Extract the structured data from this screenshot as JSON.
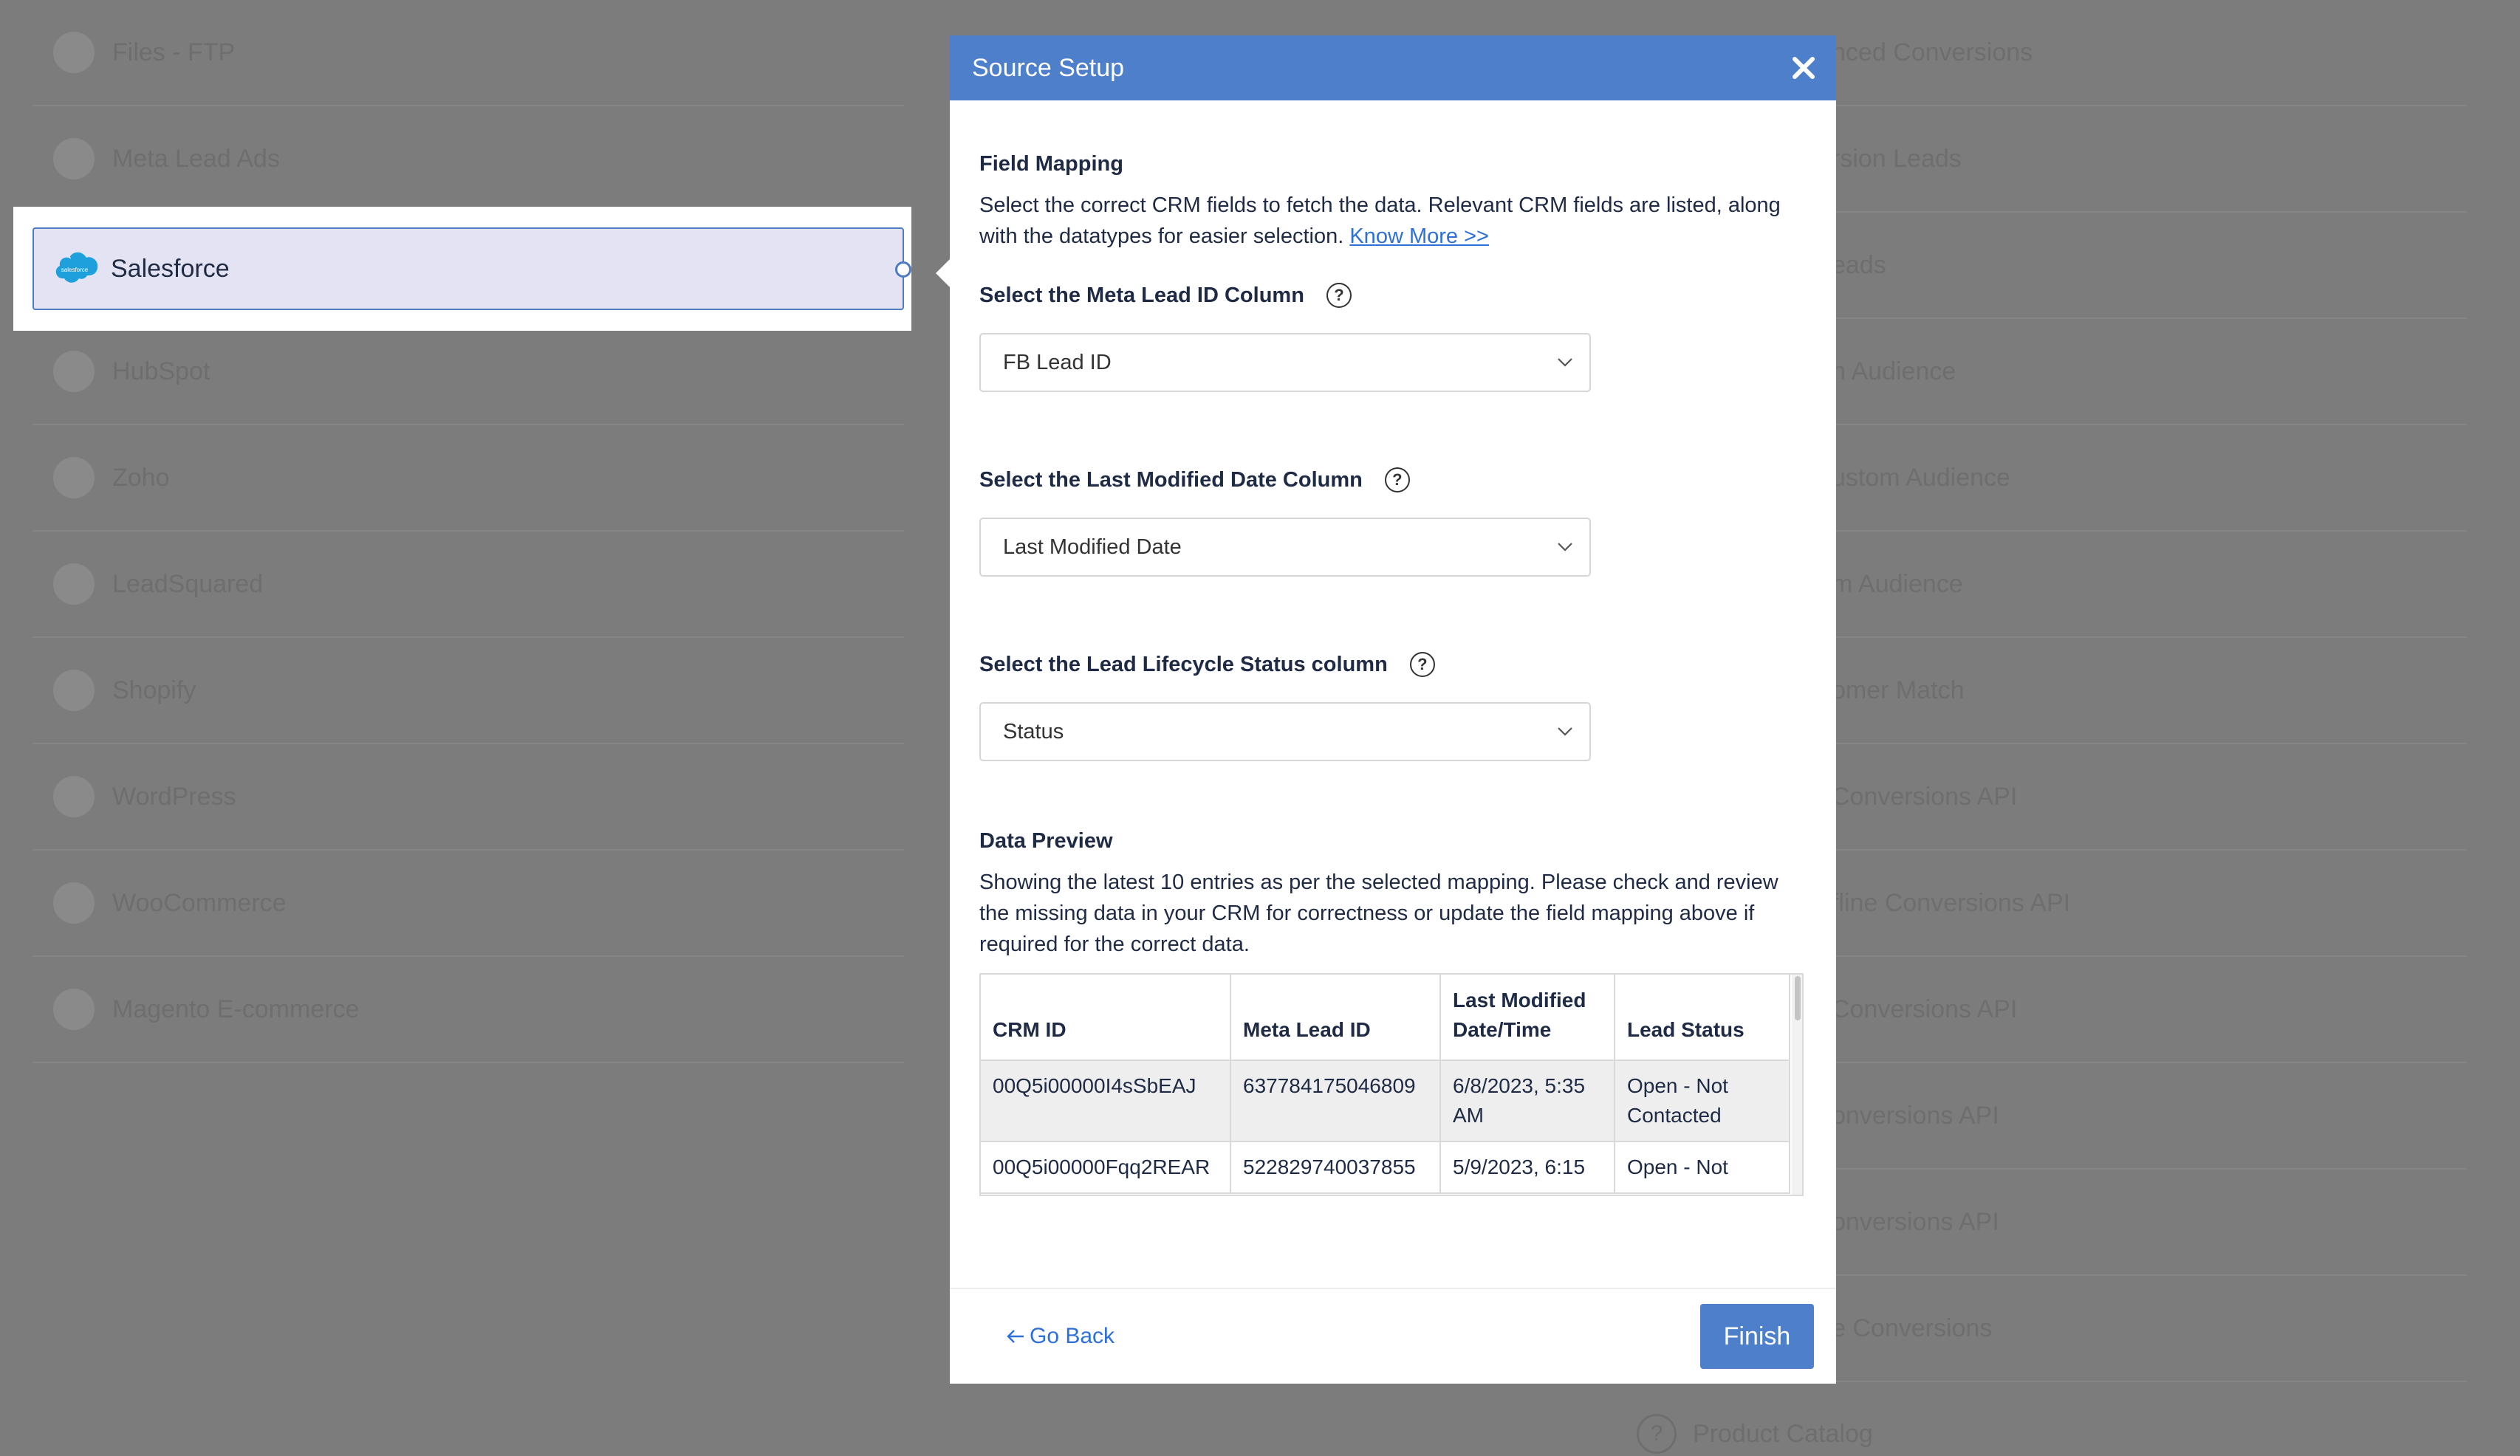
{
  "background": {
    "left_items": [
      {
        "label": "Files - FTP",
        "icon": "ftp-icon"
      },
      {
        "label": "Meta Lead Ads",
        "icon": "meta-icon"
      },
      {
        "label": "",
        "icon": "salesforce-placeholder"
      },
      {
        "label": "HubSpot",
        "icon": "hubspot-icon"
      },
      {
        "label": "Zoho",
        "icon": "zoho-icon"
      },
      {
        "label": "LeadSquared",
        "icon": "leadsquared-icon"
      },
      {
        "label": "Shopify",
        "icon": "shopify-icon"
      },
      {
        "label": "WordPress",
        "icon": "wordpress-icon"
      },
      {
        "label": "WooCommerce",
        "icon": "woocommerce-icon"
      },
      {
        "label": "Magento E-commerce",
        "icon": "magento-icon"
      }
    ],
    "right_items": [
      "nced Conversions",
      "rsion Leads",
      "eads",
      "n Audience",
      "ustom Audience",
      "m Audience",
      "omer Match",
      "Conversions API",
      "fline Conversions API",
      "Conversions API",
      "onversions API",
      "onversions API",
      "e Conversions"
    ],
    "bottom_item": {
      "label": "Product Catalog",
      "icon": "question-icon"
    }
  },
  "selected_source": {
    "label": "Salesforce",
    "icon": "salesforce-cloud-icon"
  },
  "modal": {
    "title": "Source Setup",
    "field_mapping": {
      "title": "Field Mapping",
      "description": "Select the correct CRM fields to fetch the data. Relevant CRM fields are listed, along with the datatypes for easier selection.",
      "link": "Know More >>"
    },
    "fields": [
      {
        "label": "Select the Meta Lead ID Column",
        "value": "FB Lead ID"
      },
      {
        "label": "Select the Last Modified Date Column",
        "value": "Last Modified Date"
      },
      {
        "label": "Select the Lead Lifecycle Status column",
        "value": "Status"
      }
    ],
    "data_preview": {
      "title": "Data Preview",
      "description": "Showing the latest 10 entries as per the selected mapping. Please check and review the missing data in your CRM for correctness or update the field mapping above if required for the correct data.",
      "columns": [
        "CRM ID",
        "Meta Lead ID",
        "Last Modified Date/Time",
        "Lead Status"
      ],
      "rows": [
        [
          "00Q5i00000I4sSbEAJ",
          "637784175046809",
          "6/8/2023, 5:35 AM",
          "Open - Not Contacted"
        ],
        [
          "00Q5i00000Fqq2REAR",
          "522829740037855",
          "5/9/2023, 6:15",
          "Open - Not"
        ]
      ]
    },
    "footer": {
      "back_label": "Go Back",
      "finish_label": "Finish"
    }
  }
}
